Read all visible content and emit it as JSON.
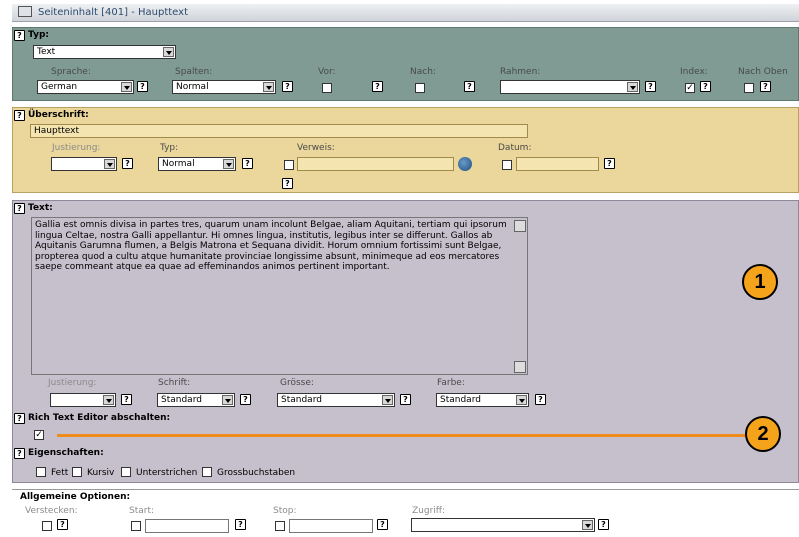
{
  "window": {
    "title": "Seiteninhalt [401] - Haupttext"
  },
  "typ": {
    "heading": "Typ:",
    "type_value": "Text",
    "labels": {
      "sprache": "Sprache:",
      "spalten": "Spalten:",
      "vor": "Vor:",
      "nach": "Nach:",
      "rahmen": "Rahmen:",
      "index": "Index:",
      "nach_oben": "Nach Oben"
    },
    "sprache_value": "German",
    "spalten_value": "Normal",
    "rahmen_value": "",
    "index_checked": "✓"
  },
  "ueberschrift": {
    "heading": "Überschrift:",
    "value": "Haupttext",
    "labels": {
      "justierung": "Justierung:",
      "typ": "Typ:",
      "verweis": "Verweis:",
      "datum": "Datum:"
    },
    "justierung_value": "",
    "typ_value": "Normal",
    "verweis_value": "",
    "datum_value": ""
  },
  "text": {
    "heading": "Text:",
    "content": "Gallia est omnis divisa in partes tres, quarum unam incolunt Belgae, aliam Aquitani, tertiam qui ipsorum lingua Celtae, nostra Galli appellantur. Hi omnes lingua, institutis, legibus inter se differunt. Gallos ab Aquitanis Garumna flumen, a Belgis Matrona et Sequana dividit. Horum omnium fortissimi sunt Belgae, propterea quod a cultu atque humanitate provinciae longissime absunt, minimeque ad eos mercatores saepe commeant atque ea quae ad effeminandos animos pertinent important.",
    "labels": {
      "justierung": "Justierung:",
      "schrift": "Schrift:",
      "groesse": "Grösse:",
      "farbe": "Farbe:"
    },
    "justierung_value": "",
    "schrift_value": "Standard",
    "groesse_value": "Standard",
    "farbe_value": "Standard",
    "rte_heading": "Rich Text Editor abschalten:",
    "rte_checked": "✓",
    "eigenschaften_heading": "Eigenschaften:",
    "eigenschaften": [
      "Fett",
      "Kursiv",
      "Unterstrichen",
      "Grossbuchstaben"
    ]
  },
  "optionen": {
    "heading": "Allgemeine Optionen:",
    "labels": {
      "verstecken": "Verstecken:",
      "start": "Start:",
      "stop": "Stop:",
      "zugriff": "Zugriff:"
    },
    "start_value": "",
    "stop_value": "",
    "zugriff_value": ""
  },
  "callouts": {
    "one": "1",
    "two": "2",
    "color": "#f6a31c",
    "line_color": "#f08c1c"
  },
  "help_glyph": "?"
}
